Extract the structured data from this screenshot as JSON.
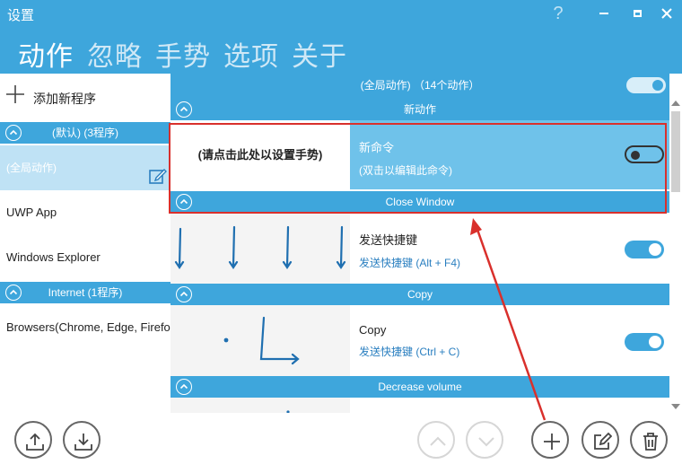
{
  "window": {
    "title": "设置",
    "help_glyph": "?"
  },
  "nav": {
    "tabs": [
      "动作",
      "忽略",
      "手势",
      "选项",
      "关于"
    ],
    "active": 0
  },
  "left": {
    "add_app_label": "添加新程序",
    "groups": [
      {
        "label": "(默认) (3程序)"
      },
      {
        "label": "Internet (1程序)"
      }
    ],
    "apps": [
      "(全局动作)",
      "UWP App",
      "Windows Explorer",
      "Browsers(Chrome, Edge, Firefox)"
    ]
  },
  "right": {
    "header": "(全局动作) （14个动作）",
    "sections": [
      "新动作",
      "Close Window",
      "Copy",
      "Decrease volume"
    ],
    "new_row": {
      "hint": "(请点击此处以设置手势)",
      "name": "新命令",
      "cmd": "(双击以编辑此命令)"
    },
    "rows": [
      {
        "name": "发送快捷键",
        "cmd": "发送快捷键 (Alt + F4)",
        "enabled": true
      },
      {
        "name": "Copy",
        "cmd": "发送快捷键 (Ctrl + C)",
        "enabled": true
      }
    ]
  },
  "colors": {
    "accent": "#3ea6dc",
    "selected": "#6fc2ea",
    "annotation": "#d9302c",
    "link": "#2a7fc0"
  }
}
